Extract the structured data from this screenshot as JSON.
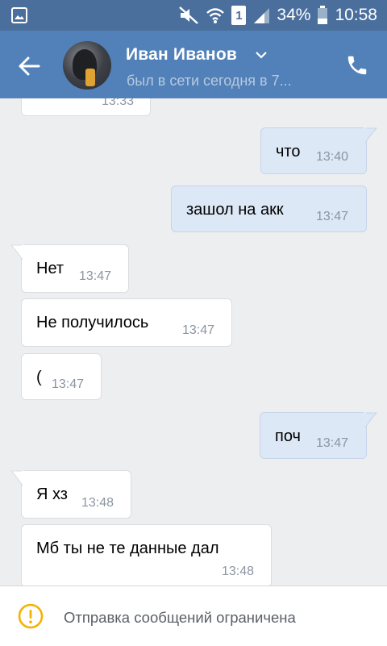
{
  "status_bar": {
    "battery": "34%",
    "time": "10:58",
    "sim": "1",
    "icons": [
      "image-icon",
      "mute-icon",
      "wifi-icon",
      "sim-icon",
      "signal-icon",
      "battery-icon"
    ]
  },
  "header": {
    "name": "Иван Иванов",
    "status": "был в сети сегодня в 7...",
    "colors": {
      "bar": "#5181b8",
      "status_bar": "#4a6f9d"
    }
  },
  "messages": [
    {
      "direction": "in",
      "text": "",
      "time": "13:33"
    },
    {
      "direction": "out",
      "text": "что",
      "time": "13:40"
    },
    {
      "direction": "out",
      "text": "зашол на акк",
      "time": "13:47"
    },
    {
      "direction": "in",
      "text": "Нет",
      "time": "13:47"
    },
    {
      "direction": "in",
      "text": "Не получилось",
      "time": "13:47"
    },
    {
      "direction": "in",
      "text": "(",
      "time": "13:47"
    },
    {
      "direction": "out",
      "text": "поч",
      "time": "13:47"
    },
    {
      "direction": "in",
      "text": "Я хз",
      "time": "13:48"
    },
    {
      "direction": "in",
      "text": "Мб ты не те данные дал",
      "time": "13:48"
    }
  ],
  "footer": {
    "text": "Отправка сообщений ограничена",
    "warning_color": "#f2b400"
  }
}
